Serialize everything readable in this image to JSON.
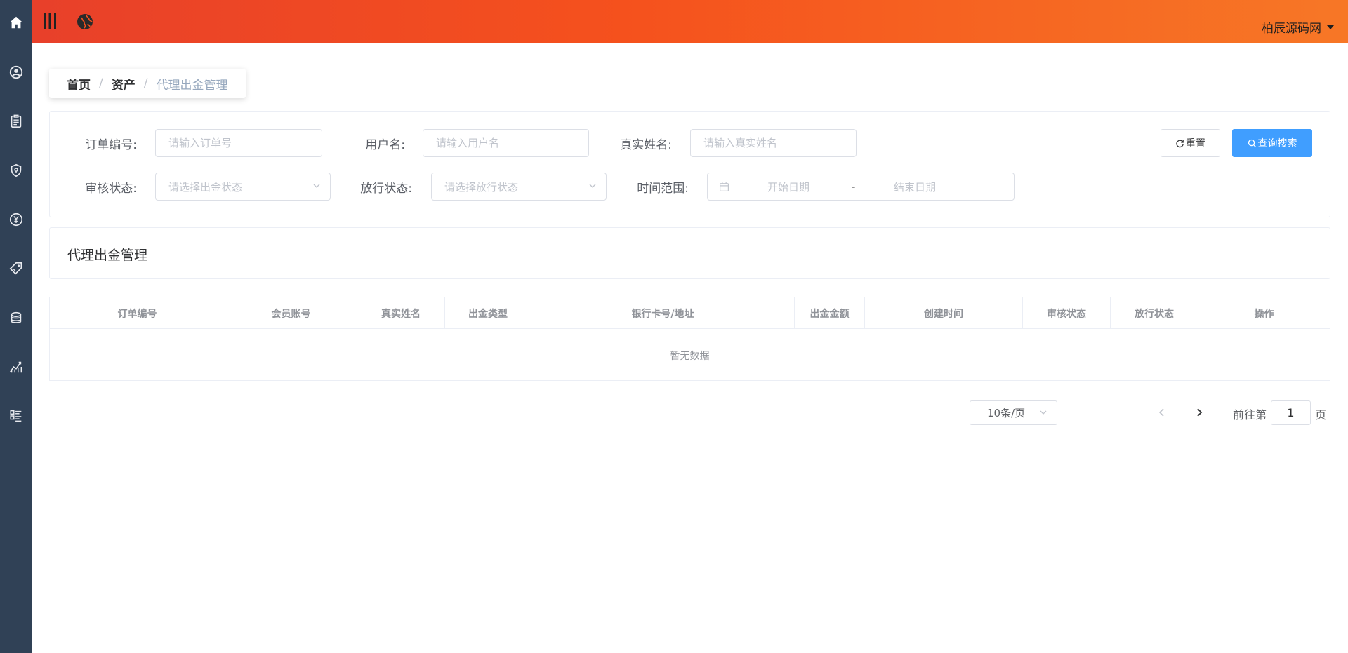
{
  "header": {
    "user_name": "柏辰源码网"
  },
  "sidebar": {
    "items": [
      {
        "icon": "home-icon"
      },
      {
        "icon": "user-circle-icon"
      },
      {
        "icon": "clipboard-icon"
      },
      {
        "icon": "shield-icon"
      },
      {
        "icon": "yuan-icon"
      },
      {
        "icon": "tag-icon"
      },
      {
        "icon": "coins-stack-icon"
      },
      {
        "icon": "chart-line-icon"
      },
      {
        "icon": "list-icon"
      }
    ]
  },
  "breadcrumb": {
    "home": "首页",
    "asset": "资产",
    "current": "代理出金管理",
    "separator": "/"
  },
  "filters": {
    "order_no": {
      "label": "订单编号:",
      "placeholder": "请输入订单号"
    },
    "username": {
      "label": "用户名:",
      "placeholder": "请输入用户名"
    },
    "real_name": {
      "label": "真实姓名:",
      "placeholder": "请输入真实姓名"
    },
    "audit_status": {
      "label": "审核状态:",
      "placeholder": "请选择出金状态"
    },
    "release_status": {
      "label": "放行状态:",
      "placeholder": "请选择放行状态"
    },
    "time_range": {
      "label": "时间范围:",
      "start_placeholder": "开始日期",
      "end_placeholder": "结束日期",
      "separator": "-"
    },
    "reset_label": "重置",
    "search_label": "查询搜索"
  },
  "section_title": "代理出金管理",
  "table": {
    "columns": [
      "订单编号",
      "会员账号",
      "真实姓名",
      "出金类型",
      "银行卡号/地址",
      "出金金额",
      "创建时间",
      "审核状态",
      "放行状态",
      "操作"
    ],
    "empty_text": "暂无数据"
  },
  "pagination": {
    "page_size": "10条/页",
    "goto_prefix": "前往第",
    "current_page": "1",
    "goto_suffix": "页"
  },
  "colors": {
    "sidebar": "#304156",
    "header_gradient_start": "#e8402a",
    "header_gradient_end": "#f77726",
    "primary": "#409eff"
  }
}
